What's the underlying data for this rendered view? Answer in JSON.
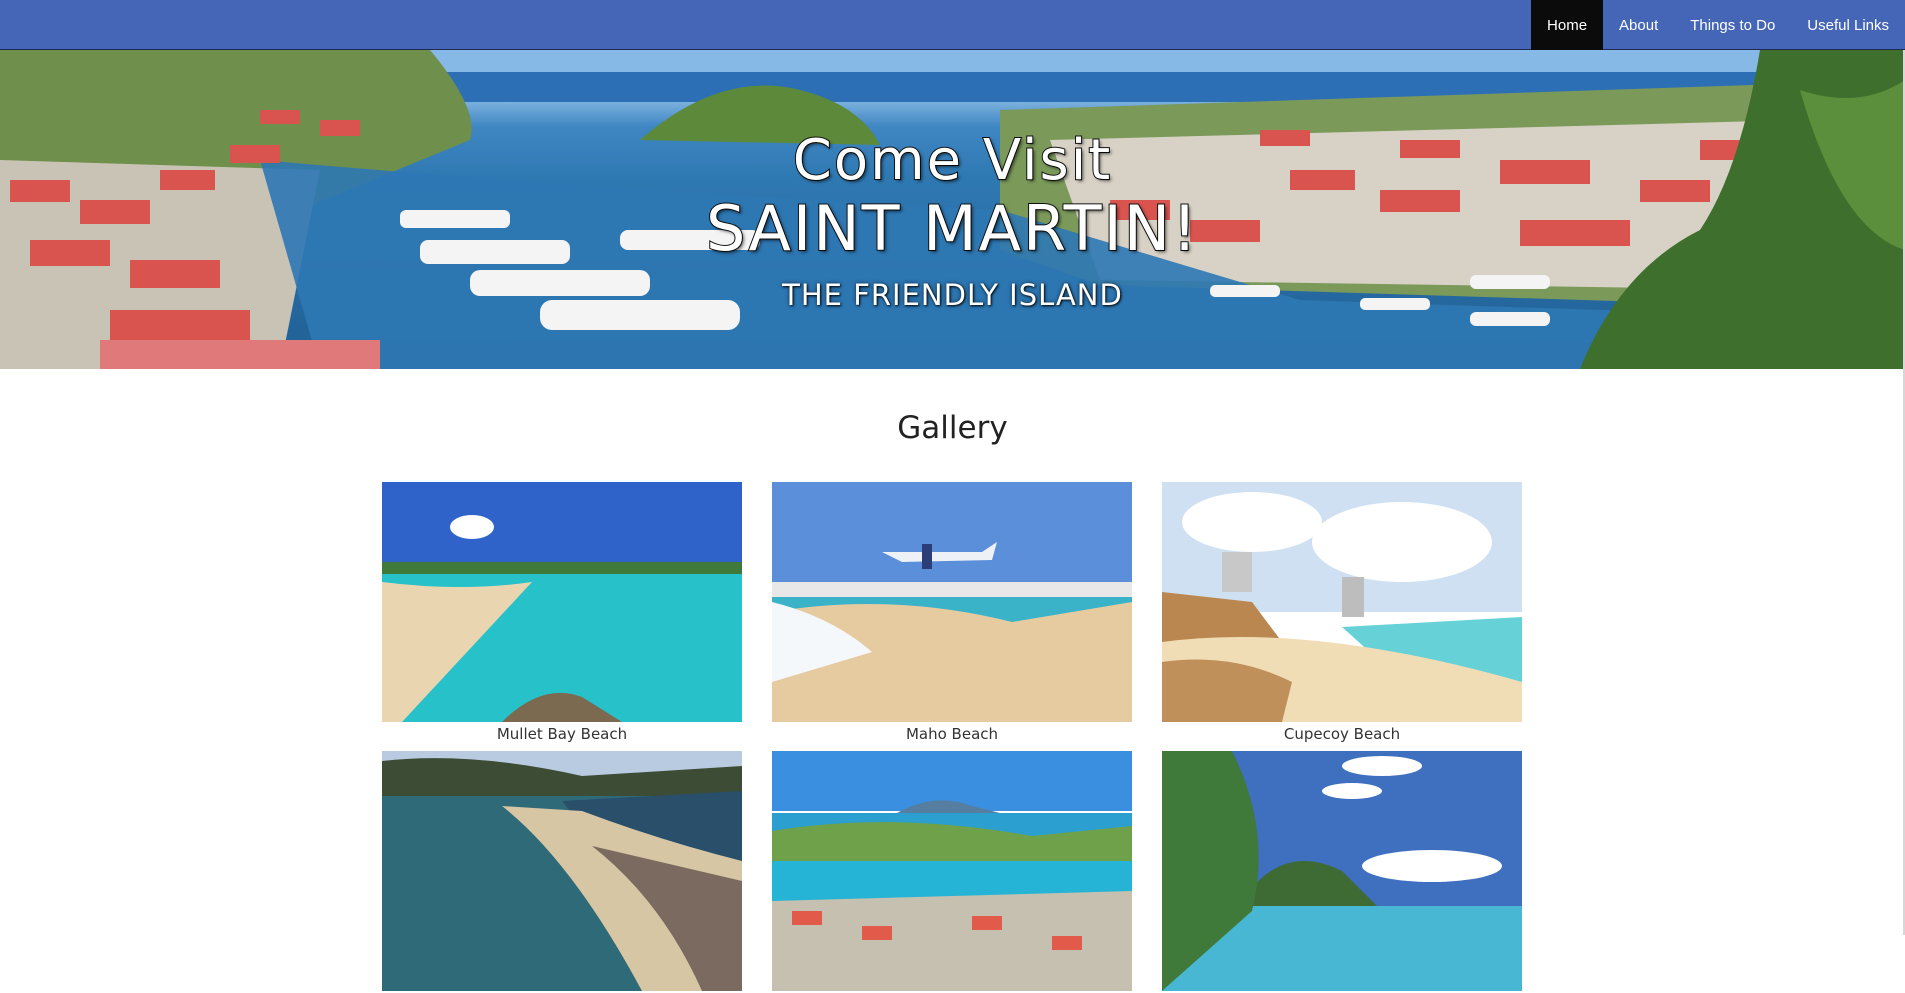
{
  "nav": {
    "items": [
      {
        "label": "Home",
        "active": true
      },
      {
        "label": "About",
        "active": false
      },
      {
        "label": "Things to Do",
        "active": false
      },
      {
        "label": "Useful Links",
        "active": false
      }
    ]
  },
  "hero": {
    "line1": "Come Visit",
    "line2": "SAINT MARTIN!",
    "subtitle": "THE FRIENDLY ISLAND"
  },
  "gallery": {
    "title": "Gallery",
    "items": [
      {
        "caption": "Mullet Bay Beach"
      },
      {
        "caption": "Maho Beach"
      },
      {
        "caption": "Cupecoy Beach"
      },
      {
        "caption": ""
      },
      {
        "caption": ""
      },
      {
        "caption": ""
      }
    ]
  },
  "colors": {
    "navbar": "#4565b6",
    "nav_active": "#0b0b0b",
    "page_bg": "#ffffff"
  }
}
